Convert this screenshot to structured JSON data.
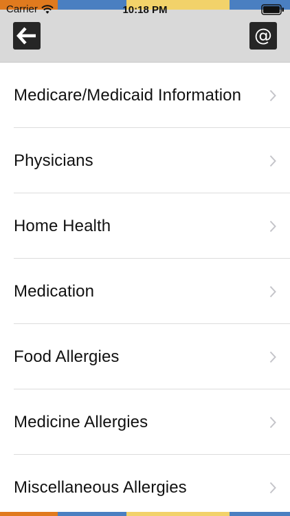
{
  "status_bar": {
    "carrier": "Carrier",
    "time": "10:18 PM"
  },
  "nav": {
    "back_icon": "arrow-left-icon",
    "email_icon": "at-icon",
    "email_glyph": "@"
  },
  "colors": {
    "stripe_orange": "#e07a1e",
    "stripe_blue": "#4a7fc1",
    "stripe_yellow": "#f2d26a",
    "nav_background": "#d9d9d9",
    "button_background": "#262626"
  },
  "menu": {
    "items": [
      {
        "label": "Medicare/Medicaid Information"
      },
      {
        "label": "Physicians"
      },
      {
        "label": "Home Health"
      },
      {
        "label": "Medication"
      },
      {
        "label": "Food Allergies"
      },
      {
        "label": "Medicine Allergies"
      },
      {
        "label": "Miscellaneous Allergies"
      }
    ]
  }
}
